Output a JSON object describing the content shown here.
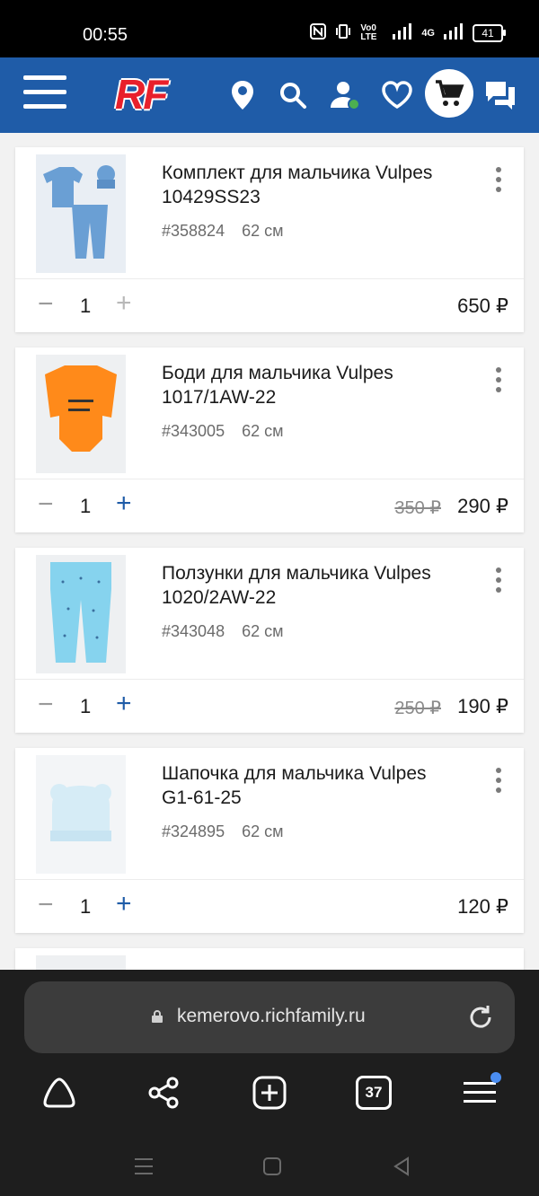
{
  "status": {
    "time": "00:55",
    "battery": "41",
    "network_labels": [
      "Vo0 LTE",
      "4G"
    ]
  },
  "header": {
    "logo": "RF"
  },
  "colors": {
    "brand": "#1f5ca8",
    "logo_red": "#e8202b",
    "accent_blue": "#1f5ca8"
  },
  "cart": {
    "items": [
      {
        "title": "Комплект для мальчика Vulpes 10429SS23",
        "sku": "#358824",
        "size": "62 см",
        "qty": "1",
        "old_price": "",
        "price": "650 ₽",
        "plus_enabled": false
      },
      {
        "title": "Боди для мальчика Vulpes 1017/1AW-22",
        "sku": "#343005",
        "size": "62 см",
        "qty": "1",
        "old_price": "350 ₽",
        "price": "290 ₽",
        "plus_enabled": true
      },
      {
        "title": "Ползунки для мальчика Vulpes 1020/2AW-22",
        "sku": "#343048",
        "size": "62 см",
        "qty": "1",
        "old_price": "250 ₽",
        "price": "190 ₽",
        "plus_enabled": true
      },
      {
        "title": "Шапочка для мальчика Vulpes G1-61-25",
        "sku": "#324895",
        "size": "62 см",
        "qty": "1",
        "old_price": "",
        "price": "120 ₽",
        "plus_enabled": true
      }
    ],
    "qty_minus": "−",
    "qty_plus": "+"
  },
  "browser": {
    "url": "kemerovo.richfamily.ru",
    "tab_count": "37"
  }
}
